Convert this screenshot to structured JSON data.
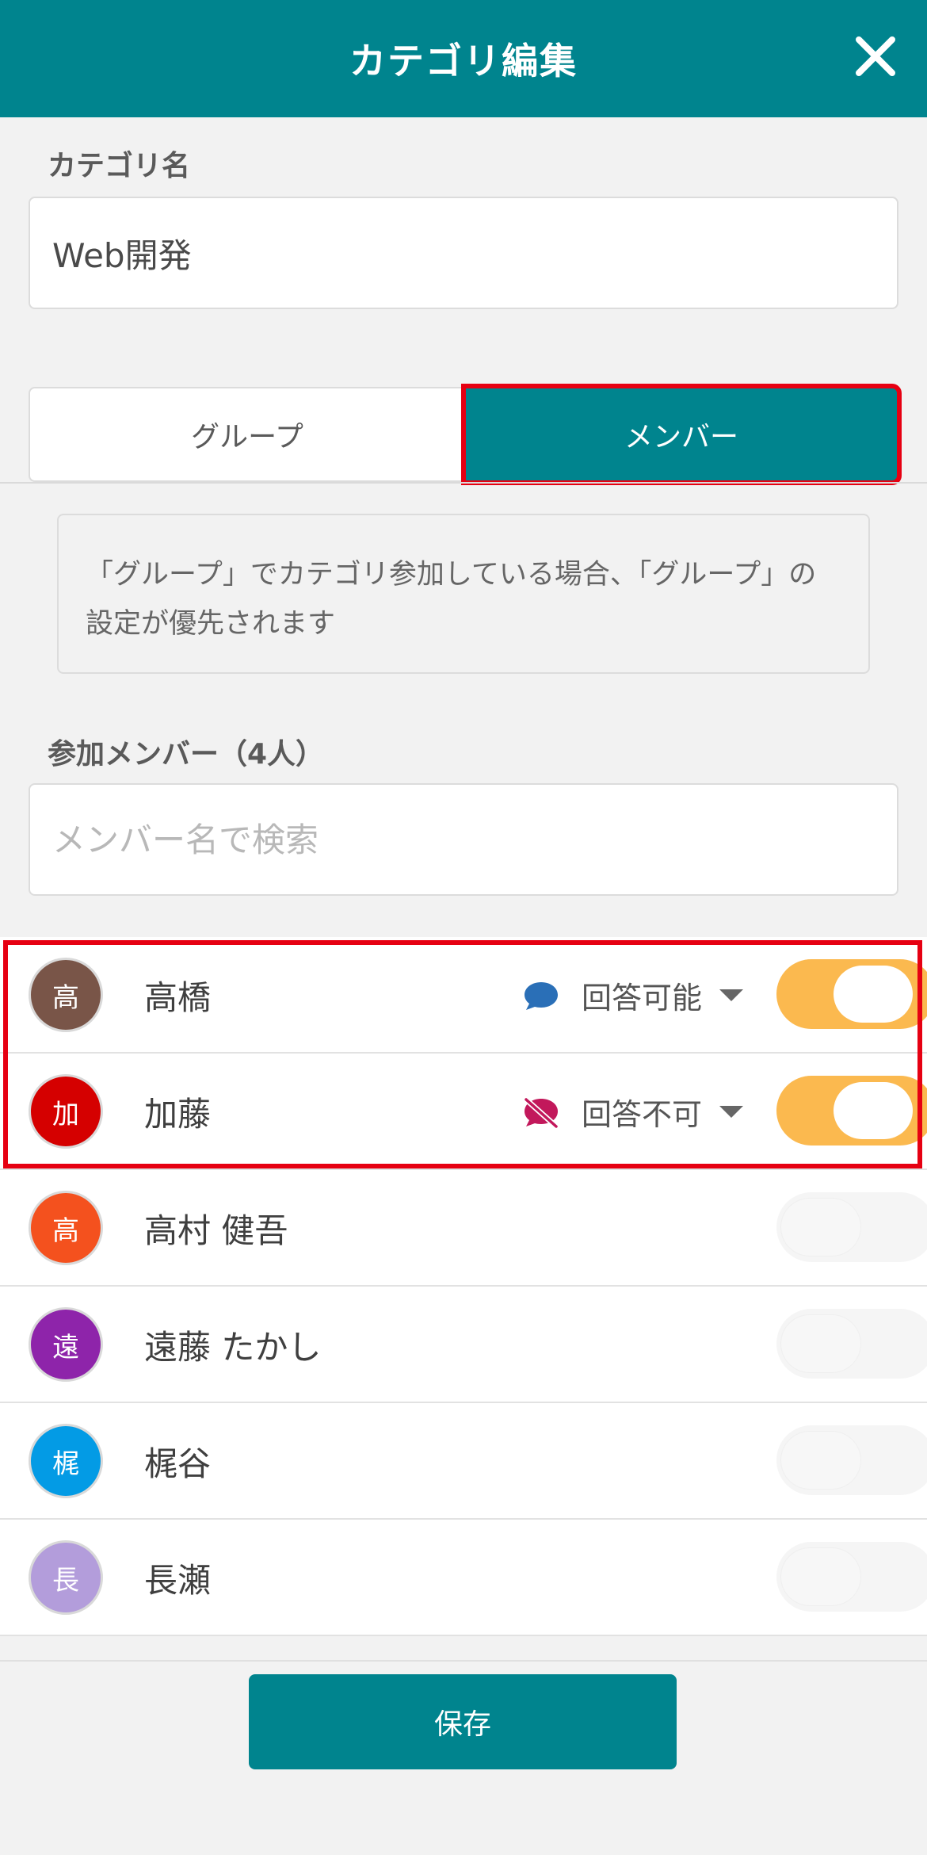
{
  "header": {
    "title": "カテゴリ編集"
  },
  "category": {
    "label": "カテゴリ名",
    "value": "Web開発"
  },
  "tabs": [
    {
      "label": "グループ",
      "active": false
    },
    {
      "label": "メンバー",
      "active": true
    }
  ],
  "notice": {
    "text": "「グループ」でカテゴリ参加している場合、「グループ」の設定が優先されます"
  },
  "members_section": {
    "label": "参加メンバー（4人）",
    "search_placeholder": "メンバー名で検索"
  },
  "members": [
    {
      "initial": "高",
      "name": "高橋",
      "avatar_color": "#795548",
      "permission": "回答可能",
      "permission_icon": "chat-bubble-icon",
      "enabled": true
    },
    {
      "initial": "加",
      "name": "加藤",
      "avatar_color": "#d50000",
      "permission": "回答不可",
      "permission_icon": "chat-off-icon",
      "enabled": true
    },
    {
      "initial": "高",
      "name": "高村 健吾",
      "avatar_color": "#f4511e",
      "permission": "",
      "enabled": false
    },
    {
      "initial": "遠",
      "name": "遠藤 たかし",
      "avatar_color": "#8e24aa",
      "permission": "",
      "enabled": false
    },
    {
      "initial": "梶",
      "name": "梶谷",
      "avatar_color": "#039be5",
      "permission": "",
      "enabled": false
    },
    {
      "initial": "長",
      "name": "長瀬",
      "avatar_color": "#b39ddb",
      "permission": "",
      "enabled": false
    }
  ],
  "footer": {
    "save_label": "保存"
  },
  "colors": {
    "primary": "#00848e",
    "toggle_on": "#fbb94f",
    "highlight": "#e60012"
  }
}
